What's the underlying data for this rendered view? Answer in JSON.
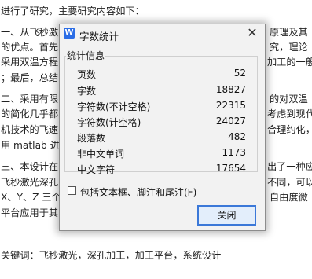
{
  "document": {
    "lines": [
      "进行了研究，主要研究内容如下：",
      "一、从飞秒激",
      "的优点。首先",
      "采用双温方程",
      "；最后，总结",
      "二、采用有限",
      "的简化几乎都",
      "机技术的飞速",
      "用 matlab 进行",
      "三、本设计在",
      "飞秒激光深孔",
      "X、Y、Z 三个",
      "平台应用于其"
    ],
    "right_fragments": [
      "原理及其",
      "究，理论",
      "加工的一般",
      "的对双温",
      "考虑到现代",
      "合理约化，",
      "出了一种应",
      "不同，可以",
      "自由度微"
    ],
    "keywords_line": "关键词：飞秒激光，深孔加工，加工平台，系统设计"
  },
  "dialog": {
    "app_icon_letter": "W",
    "title": "字数统计",
    "group_label": "统计信息",
    "stats": [
      {
        "label": "页数",
        "value": "52"
      },
      {
        "label": "字数",
        "value": "18827"
      },
      {
        "label": "字符数(不计空格)",
        "value": "22315"
      },
      {
        "label": "字符数(计空格)",
        "value": "24027"
      },
      {
        "label": "段落数",
        "value": "482"
      },
      {
        "label": "非中文单词",
        "value": "1173"
      },
      {
        "label": "中文字符",
        "value": "17654"
      }
    ],
    "checkbox_label": "包括文本框、脚注和尾注(F)",
    "checkbox_checked": false,
    "close_button_label": "关闭",
    "close_icon": "close-icon",
    "accent_color": "#3b78d8",
    "icon_color": "#2b6de6"
  }
}
